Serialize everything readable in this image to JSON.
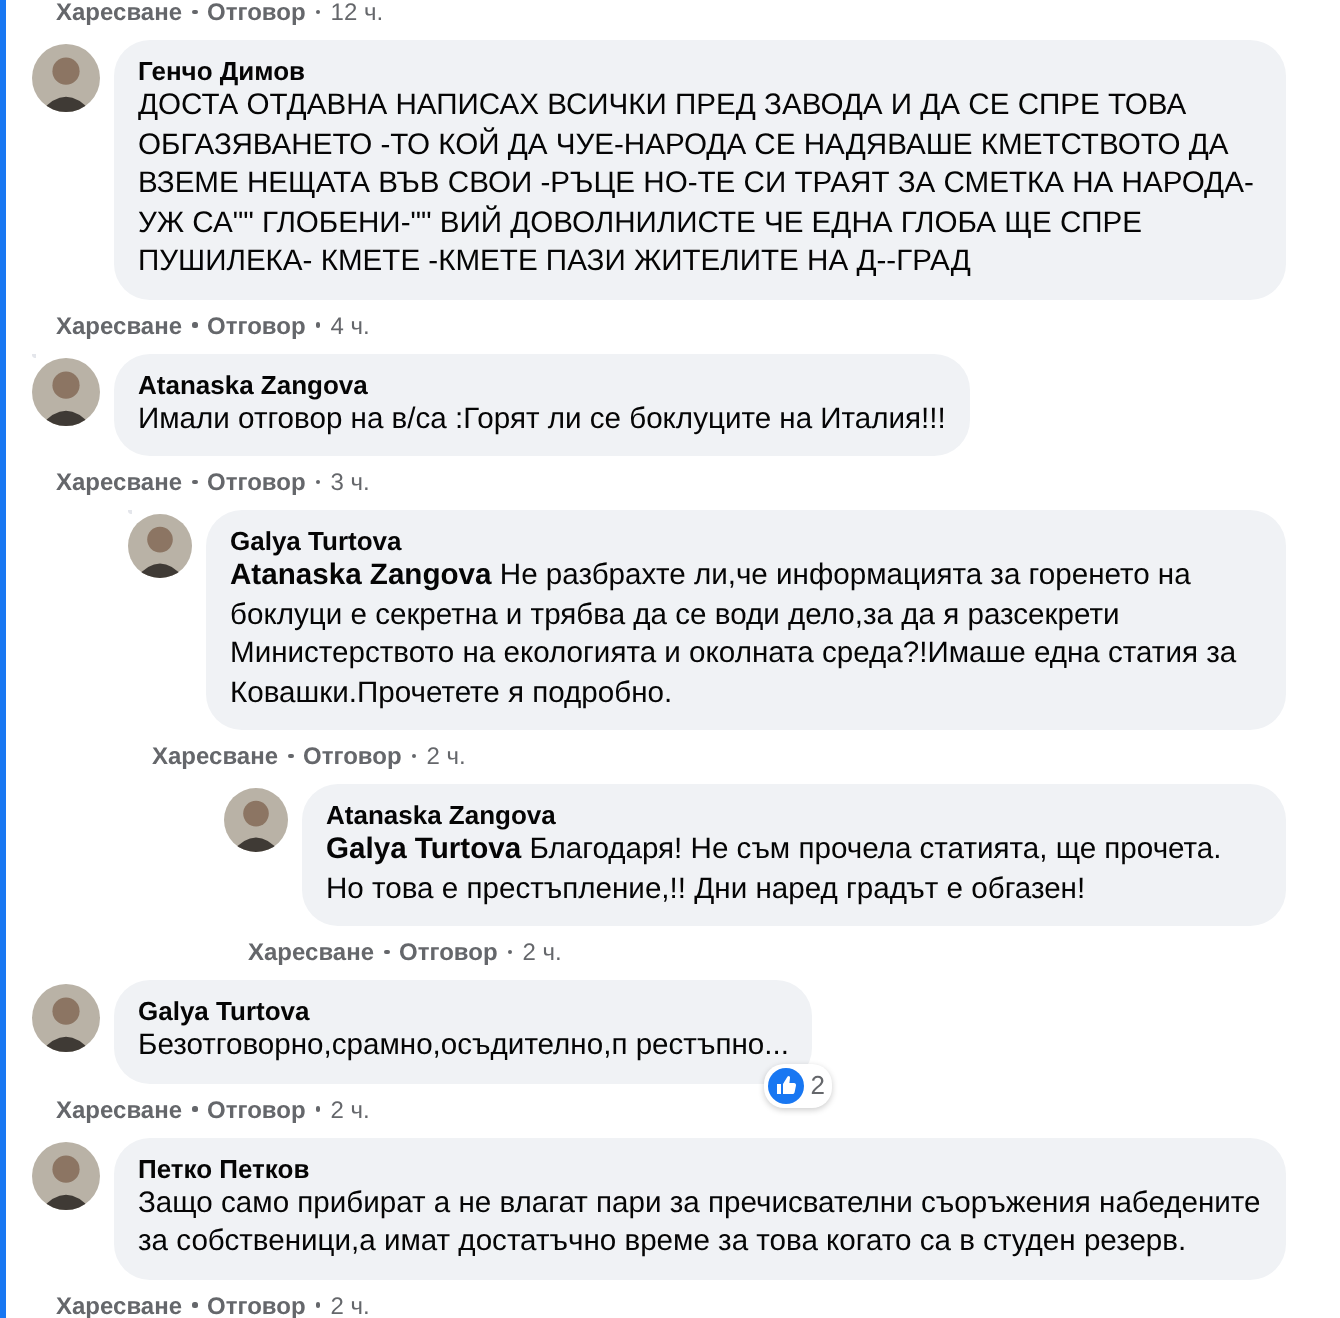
{
  "previous_comment_actions": {
    "like": "Харесване",
    "reply": "Отговор",
    "time": "12 ч."
  },
  "comments": [
    {
      "author": "Генчо Димов",
      "text": "ДОСТА ОТДАВНА НАПИСАХ ВСИЧКИ ПРЕД ЗАВОДА И ДА СЕ СПРЕ ТОВА ОБГАЗЯВАНЕТО -ТО КОЙ ДА ЧУЕ-НАРОДА СЕ НАДЯВАШЕ КМЕТСТВОТО ДА ВЗЕМЕ НЕЩАТА ВЪВ СВОИ -РЪЦЕ НО-ТЕ СИ ТРАЯТ ЗА СМЕТКА НА НАРОДА- УЖ СА\"\" ГЛОБЕНИ-\"\" ВИЙ ДОВОЛНИЛИСТЕ ЧЕ ЕДНА ГЛОБА ЩЕ СПРЕ ПУШИЛЕКА- КМЕТЕ -КМЕТЕ ПАЗИ ЖИТЕЛИТЕ НА Д--ГРАД",
      "actions": {
        "like": "Харесване",
        "reply": "Отговор",
        "time": "4 ч."
      }
    },
    {
      "author": "Atanaska Zangova",
      "text": "Имали отговор на в/са :Горят ли се боклуците на Италия!!!",
      "actions": {
        "like": "Харесване",
        "reply": "Отговор",
        "time": "3 ч."
      },
      "children": [
        {
          "author": "Galya Turtova",
          "mention": "Atanaska Zangova",
          "text": "Не разбрахте ли,че информацията за горенето на боклуци е секретна и трябва да се води дело,за да я разсекрети Министерството на екологията и околната среда?!Имаше една статия за Ковашки.Прочетете я подробно.",
          "actions": {
            "like": "Харесване",
            "reply": "Отговор",
            "time": "2 ч."
          },
          "children": [
            {
              "author": "Atanaska Zangova",
              "mention": "Galya Turtova",
              "text": "Благодаря! Не съм прочела статията, ще прочета. Но това е престъпление,!! Дни наред градът е обгазен!",
              "actions": {
                "like": "Харесване",
                "reply": "Отговор",
                "time": "2 ч."
              }
            }
          ]
        }
      ]
    },
    {
      "author": "Galya Turtova",
      "text": "Безотговорно,срамно,осъдително,п рестъпно...",
      "reactions": {
        "count": "2"
      },
      "actions": {
        "like": "Харесване",
        "reply": "Отговор",
        "time": "2 ч."
      }
    },
    {
      "author": "Петко Петков",
      "text": "Защо само прибират а не влагат пари за пречисвателни съоръжения набедените за собственици,а имат достатъчно време за това когато са в студен резерв.",
      "actions": {
        "like": "Харесване",
        "reply": "Отговор",
        "time": "2 ч."
      }
    }
  ]
}
